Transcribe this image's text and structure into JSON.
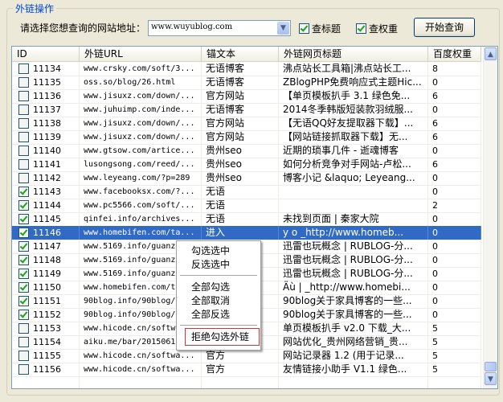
{
  "group": {
    "title": "外链操作"
  },
  "toolbar": {
    "url_label": "请选择您想查询的网站地址：",
    "url_value": "www.wuyublog.com",
    "check_title_label": "查标题",
    "check_title_checked": true,
    "check_weight_label": "查权重",
    "check_weight_checked": true,
    "start_button": "开始查询"
  },
  "table": {
    "columns": [
      "ID",
      "外链URL",
      "锚文本",
      "外链网页标题",
      "百度权重"
    ],
    "selected_index": 12,
    "rows": [
      {
        "checked": false,
        "id": "11134",
        "url": "www.crsky.com/soft/3...",
        "anchor": "无语博客",
        "title": "沸点站长工具箱|沸点站长工...",
        "weight": "8"
      },
      {
        "checked": false,
        "id": "11135",
        "url": "oss.so/blog/26.html",
        "anchor": "无语博客",
        "title": "ZBlogPHP免费响应式主题Hic...",
        "weight": "0"
      },
      {
        "checked": false,
        "id": "11136",
        "url": "www.jisuxz.com/down/...",
        "anchor": "官方网站",
        "title": "【单页模板扒手 3.1 绿色免...",
        "weight": "6"
      },
      {
        "checked": false,
        "id": "11137",
        "url": "www.juhuimp.com/inde...",
        "anchor": "无语博客",
        "title": "2014冬季韩版短装款羽绒服...",
        "weight": "0"
      },
      {
        "checked": false,
        "id": "11138",
        "url": "www.jisuxz.com/down/...",
        "anchor": "官方网站",
        "title": "【无语QQ好友提取器下载】...",
        "weight": "6"
      },
      {
        "checked": false,
        "id": "11139",
        "url": "www.jisuxz.com/down/...",
        "anchor": "官方网站",
        "title": "【网站链接抓取器下载】无...",
        "weight": "6"
      },
      {
        "checked": false,
        "id": "11140",
        "url": "www.gtsow.com/artice...",
        "anchor": "贵州seo",
        "title": "近期的琐事几件 - 逝魂博客",
        "weight": "0"
      },
      {
        "checked": false,
        "id": "11141",
        "url": "lusongsong.com/reed/...",
        "anchor": "贵州seo",
        "title": "如何分析竞争对手网站-卢松...",
        "weight": "6"
      },
      {
        "checked": false,
        "id": "11142",
        "url": "www.leyeang.com/?p=289",
        "anchor": "贵州seo",
        "title": "博客小记 &laquo;  Leyeang...",
        "weight": "0"
      },
      {
        "checked": true,
        "id": "11143",
        "url": "www.facebooksx.com/?...",
        "anchor": "无语",
        "title": "",
        "weight": "0"
      },
      {
        "checked": true,
        "id": "11144",
        "url": "www.pc5566.com/soft/...",
        "anchor": "无语",
        "title": "",
        "weight": "2"
      },
      {
        "checked": true,
        "id": "11145",
        "url": "qinfei.info/archives...",
        "anchor": "无语",
        "title": "未找到页面 | 秦家大院",
        "weight": "0"
      },
      {
        "checked": true,
        "id": "11146",
        "url": "www.homebifen.com/ta...",
        "anchor": "进入",
        "title": "   y  o  _http://www.homeb...",
        "weight": "0"
      },
      {
        "checked": true,
        "id": "11147",
        "url": "www.5169.info/guanzl",
        "anchor": "",
        "title": "迅雷也玩概念 | RUBLOG-分...",
        "weight": "0"
      },
      {
        "checked": true,
        "id": "11148",
        "url": "www.5169.info/guanzl",
        "anchor": "",
        "title": "迅雷也玩概念 | RUBLOG-分...",
        "weight": "0"
      },
      {
        "checked": true,
        "id": "11149",
        "url": "www.5169.info/guanzl",
        "anchor": "",
        "title": "迅雷也玩概念 | RUBLOG-分...",
        "weight": "0"
      },
      {
        "checked": true,
        "id": "11150",
        "url": "www.homebifen.com/t:",
        "anchor": "",
        "title": "  Äù | _http://www.homebi...",
        "weight": "0"
      },
      {
        "checked": true,
        "id": "11151",
        "url": "90blog.info/90blog/2",
        "anchor": "",
        "title": "90blog关于家具博客的一些...",
        "weight": "0"
      },
      {
        "checked": true,
        "id": "11152",
        "url": "90blog.info/90blog/2",
        "anchor": "",
        "title": "90blog关于家具博客的一些...",
        "weight": "0"
      },
      {
        "checked": false,
        "id": "11153",
        "url": "www.hicode.cn/softw:",
        "anchor": "",
        "title": "单页模板扒手 v2.0 下载_大...",
        "weight": "5"
      },
      {
        "checked": false,
        "id": "11154",
        "url": "aiku.me/bar/2015061:",
        "anchor": "",
        "title": "网站优化_贵州网络营销_贵...",
        "weight": "5"
      },
      {
        "checked": false,
        "id": "11155",
        "url": "www.hicode.cn/softwa...",
        "anchor": "官方",
        "title": "网站记录器 1.2 (用于记录...",
        "weight": "5"
      },
      {
        "checked": false,
        "id": "11156",
        "url": "www.hicode.cn/softwa...",
        "anchor": "官方",
        "title": "友情链接小助手 V1.1 绿色...",
        "weight": "5"
      }
    ]
  },
  "context_menu": {
    "items": [
      "勾选选中",
      "反选选中",
      "全部勾选",
      "全部取消",
      "全部反选",
      "拒绝勾选外链"
    ],
    "highlighted": "拒绝勾选外链"
  },
  "scrollbar": {
    "up_icon": "▲",
    "down_icon": "▼",
    "position_fraction": 1.0
  },
  "colors": {
    "selection": "#316ac5",
    "group_title": "#0046d5",
    "check_mark": "#21a121",
    "menu_highlight_border": "#c23a3a"
  }
}
